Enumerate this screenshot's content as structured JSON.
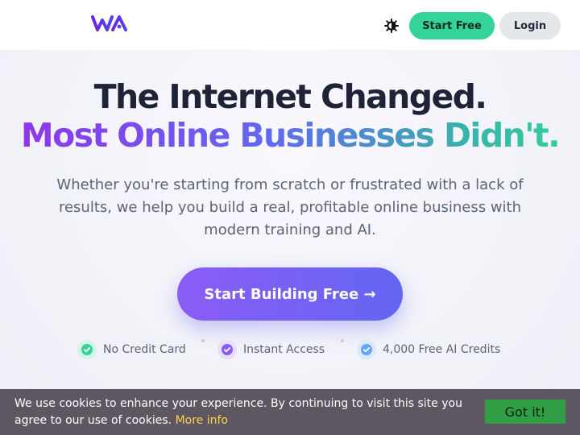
{
  "header": {
    "start_free_label": "Start Free",
    "login_label": "Login"
  },
  "hero": {
    "headline_line1": "The Internet Changed.",
    "headline_line2": "Most Online Businesses Didn't.",
    "subtitle": "Whether you're starting from scratch or frustrated with a lack of results, we help you build a real, profitable online business with modern training and AI.",
    "cta_label": "Start Building Free →"
  },
  "features": [
    {
      "label": "No Credit Card",
      "icon": "check-circle-icon",
      "color": "#34d399"
    },
    {
      "label": "Instant Access",
      "icon": "check-circle-icon",
      "color": "#8b5cf6"
    },
    {
      "label": "4,000 Free AI Credits",
      "icon": "check-circle-icon",
      "color": "#60a5fa"
    }
  ],
  "cookie": {
    "text": "We use cookies to enhance your experience. By continuing to visit this site you agree to our use of cookies.",
    "more_info": "More info",
    "button_label": "Got it!"
  },
  "colors": {
    "accent_green": "#34d399",
    "accent_purple": "#8b5cf6",
    "accent_indigo": "#6366f1",
    "cookie_bar": "#5e5660",
    "cookie_link": "#fcd34d",
    "cookie_button": "#2f9e44"
  }
}
